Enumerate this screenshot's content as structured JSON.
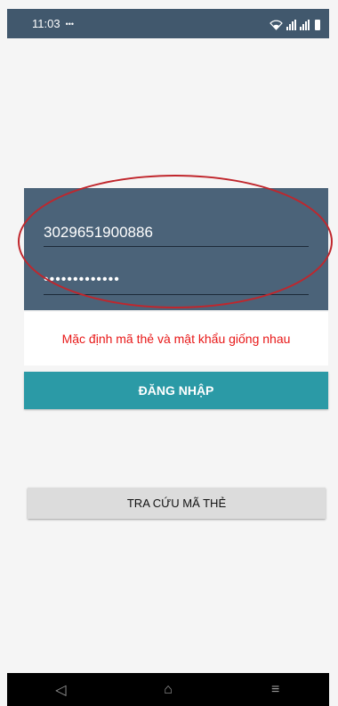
{
  "status_bar": {
    "time": "11:03",
    "more_indicator": "•••",
    "icons": [
      "wifi-icon",
      "signal-icon",
      "signal-icon",
      "battery-icon"
    ]
  },
  "login": {
    "card_number_value": "3029651900886",
    "password_value": "•••••••••••••",
    "hint": "Mặc định mã thẻ và mật khẩu giống nhau",
    "login_button_label": "ĐĂNG NHẬP"
  },
  "lookup": {
    "button_label": "TRA CỨU MÃ THẺ"
  },
  "nav_bar": {
    "back": "◁",
    "home": "⌂",
    "menu": "≡"
  },
  "colors": {
    "status_bar": "#41586d",
    "panel": "#4b6379",
    "login_button": "#2b9aa6",
    "hint_text": "#e81818",
    "annotation": "#c0262c"
  }
}
